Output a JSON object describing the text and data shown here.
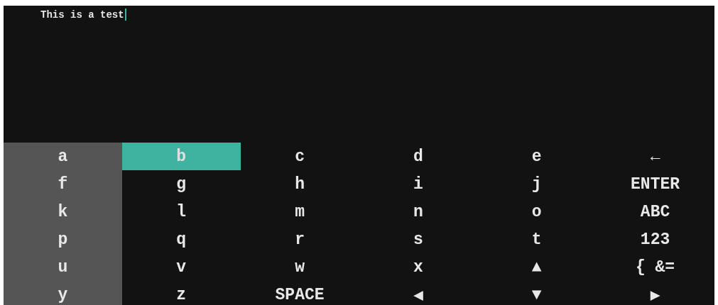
{
  "input": {
    "value": "This is a test",
    "cursor": true
  },
  "keyboard": {
    "rows": [
      [
        {
          "label": "a",
          "selected": false,
          "highlighted": true
        },
        {
          "label": "b",
          "selected": true,
          "highlighted": false
        },
        {
          "label": "c",
          "selected": false,
          "highlighted": false
        },
        {
          "label": "d",
          "selected": false,
          "highlighted": false
        },
        {
          "label": "e",
          "selected": false,
          "highlighted": false
        },
        {
          "label": "←",
          "selected": false,
          "highlighted": false
        }
      ],
      [
        {
          "label": "f",
          "selected": false,
          "highlighted": true
        },
        {
          "label": "g",
          "selected": false,
          "highlighted": false
        },
        {
          "label": "h",
          "selected": false,
          "highlighted": false
        },
        {
          "label": "i",
          "selected": false,
          "highlighted": false
        },
        {
          "label": "j",
          "selected": false,
          "highlighted": false
        },
        {
          "label": "ENTER",
          "selected": false,
          "highlighted": false
        }
      ],
      [
        {
          "label": "k",
          "selected": false,
          "highlighted": true
        },
        {
          "label": "l",
          "selected": false,
          "highlighted": false
        },
        {
          "label": "m",
          "selected": false,
          "highlighted": false
        },
        {
          "label": "n",
          "selected": false,
          "highlighted": false
        },
        {
          "label": "o",
          "selected": false,
          "highlighted": false
        },
        {
          "label": "ABC",
          "selected": false,
          "highlighted": false
        }
      ],
      [
        {
          "label": "p",
          "selected": false,
          "highlighted": true
        },
        {
          "label": "q",
          "selected": false,
          "highlighted": false
        },
        {
          "label": "r",
          "selected": false,
          "highlighted": false
        },
        {
          "label": "s",
          "selected": false,
          "highlighted": false
        },
        {
          "label": "t",
          "selected": false,
          "highlighted": false
        },
        {
          "label": "123",
          "selected": false,
          "highlighted": false
        }
      ],
      [
        {
          "label": "u",
          "selected": false,
          "highlighted": true
        },
        {
          "label": "v",
          "selected": false,
          "highlighted": false
        },
        {
          "label": "w",
          "selected": false,
          "highlighted": false
        },
        {
          "label": "x",
          "selected": false,
          "highlighted": false
        },
        {
          "label": "▲",
          "selected": false,
          "highlighted": false
        },
        {
          "label": "{ &=",
          "selected": false,
          "highlighted": false
        }
      ],
      [
        {
          "label": "y",
          "selected": false,
          "highlighted": true
        },
        {
          "label": "z",
          "selected": false,
          "highlighted": false
        },
        {
          "label": "SPACE",
          "selected": false,
          "highlighted": false
        },
        {
          "label": "◀",
          "selected": false,
          "highlighted": false
        },
        {
          "label": "▼",
          "selected": false,
          "highlighted": false
        },
        {
          "label": "▶",
          "selected": false,
          "highlighted": false
        }
      ]
    ]
  }
}
